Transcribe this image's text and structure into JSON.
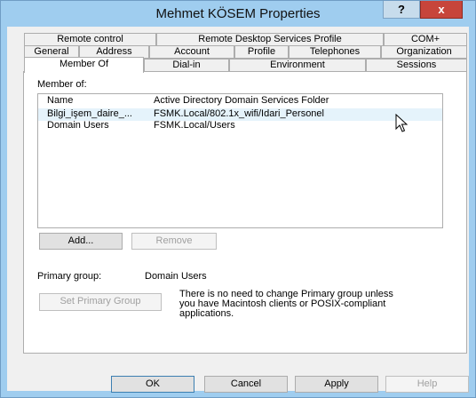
{
  "window": {
    "title": "Mehmet KÖSEM Properties",
    "help_glyph": "?",
    "close_glyph": "x"
  },
  "tabs": {
    "row1": [
      "Remote control",
      "Remote Desktop Services Profile",
      "COM+"
    ],
    "row2": [
      "General",
      "Address",
      "Account",
      "Profile",
      "Telephones",
      "Organization"
    ],
    "row3": [
      "Member Of",
      "Dial-in",
      "Environment",
      "Sessions"
    ],
    "selected": "Member Of"
  },
  "member_of": {
    "label": "Member of:",
    "columns": [
      "Name",
      "Active Directory Domain Services Folder"
    ],
    "rows": [
      {
        "name": "Bilgi_işem_daire_...",
        "folder": "FSMK.Local/802.1x_wifi/Idari_Personel"
      },
      {
        "name": "Domain Users",
        "folder": "FSMK.Local/Users"
      }
    ]
  },
  "buttons": {
    "add": "Add...",
    "remove": "Remove",
    "set_primary": "Set Primary Group",
    "ok": "OK",
    "cancel": "Cancel",
    "apply": "Apply",
    "help": "Help"
  },
  "primary_group": {
    "label": "Primary group:",
    "value": "Domain Users",
    "note_line1": "There is no need to change Primary group unless",
    "note_line2": "you have Macintosh clients or POSIX-compliant",
    "note_line3": "applications."
  },
  "colors": {
    "frame": "#9fcdef",
    "close": "#c7453b",
    "hover_row": "#e5f3fb"
  }
}
